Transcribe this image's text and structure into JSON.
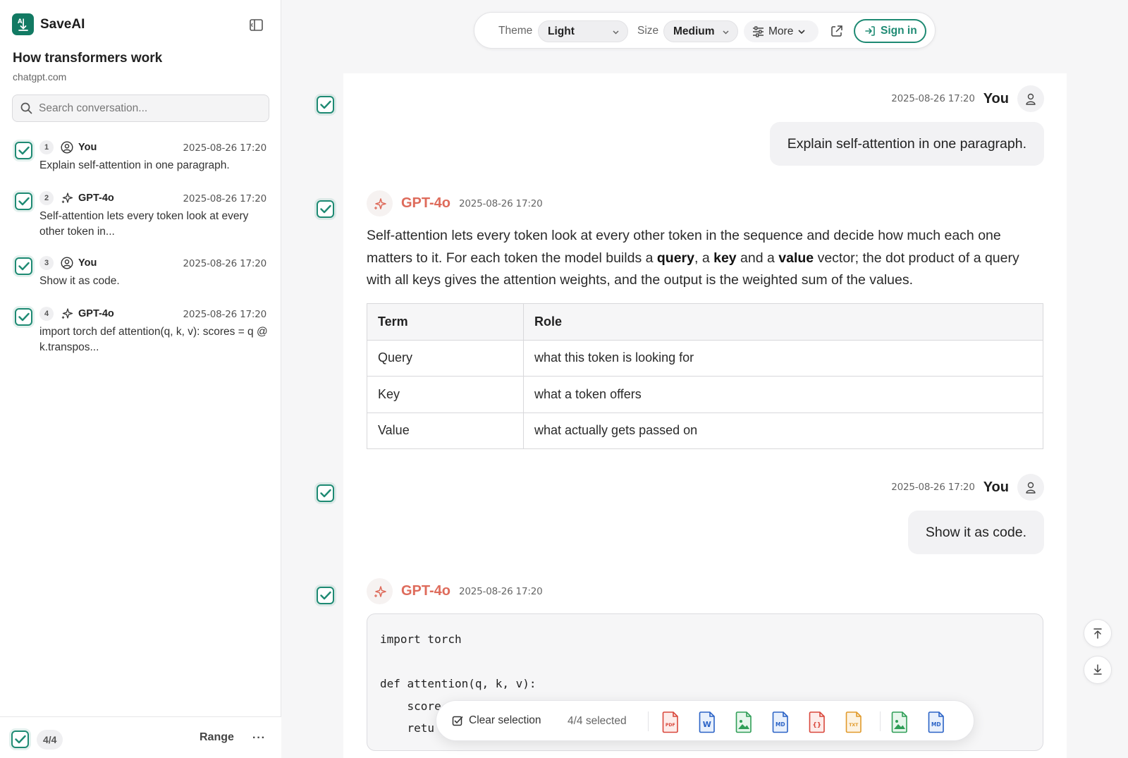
{
  "app": {
    "name": "SaveAI"
  },
  "conversation": {
    "title": "How transformers work",
    "domain": "chatgpt.com"
  },
  "search": {
    "placeholder": "Search conversation..."
  },
  "sidebar_messages": [
    {
      "number": "1",
      "role": "You",
      "time": "2025-08-26 17:20",
      "preview": "Explain self-attention in one paragraph."
    },
    {
      "number": "2",
      "role": "GPT-4o",
      "time": "2025-08-26 17:20",
      "preview": "Self-attention lets every token look at every other token in..."
    },
    {
      "number": "3",
      "role": "You",
      "time": "2025-08-26 17:20",
      "preview": "Show it as code."
    },
    {
      "number": "4",
      "role": "GPT-4o",
      "time": "2025-08-26 17:20",
      "preview": "import torch def attention(q, k, v): scores = q @ k.transpos..."
    }
  ],
  "footer": {
    "count": "4/4",
    "range_label": "Range",
    "more_label": "···"
  },
  "toolbar": {
    "theme_label": "Theme",
    "theme_value": "Light",
    "size_label": "Size",
    "size_value": "Medium",
    "more_label": "More",
    "signin_label": "Sign in"
  },
  "messages": {
    "m1": {
      "author": "You",
      "time": "2025-08-26 17:20",
      "text": "Explain self-attention in one paragraph."
    },
    "m2": {
      "author": "GPT-4o",
      "time": "2025-08-26 17:20",
      "text_parts": {
        "p1": "Self-attention lets every token look at every other token in the sequence and decide how much each one matters to it. For each token the model builds a ",
        "b1": "query",
        "p2": ", a ",
        "b2": "key",
        "p3": " and a ",
        "b3": "value",
        "p4": " vector; the dot product of a query with all keys gives the attention weights, and the output is the weighted sum of the values."
      },
      "table": {
        "headers": [
          "Term",
          "Role"
        ],
        "rows": [
          [
            "Query",
            "what this token is looking for"
          ],
          [
            "Key",
            "what a token offers"
          ],
          [
            "Value",
            "what actually gets passed on"
          ]
        ]
      }
    },
    "m3": {
      "author": "You",
      "time": "2025-08-26 17:20",
      "text": "Show it as code."
    },
    "m4": {
      "author": "GPT-4o",
      "time": "2025-08-26 17:20",
      "code": "import torch\n\ndef attention(q, k, v):\n    score\n    retu"
    }
  },
  "selection_bar": {
    "clear_label": "Clear selection",
    "selected_label": "4/4 selected",
    "formats": [
      "PDF",
      "W",
      "image",
      "MD",
      "{}",
      "TXT",
      "image",
      "MD"
    ]
  },
  "colors": {
    "accent": "#1e8a73",
    "ai_name": "#de6b5b"
  }
}
